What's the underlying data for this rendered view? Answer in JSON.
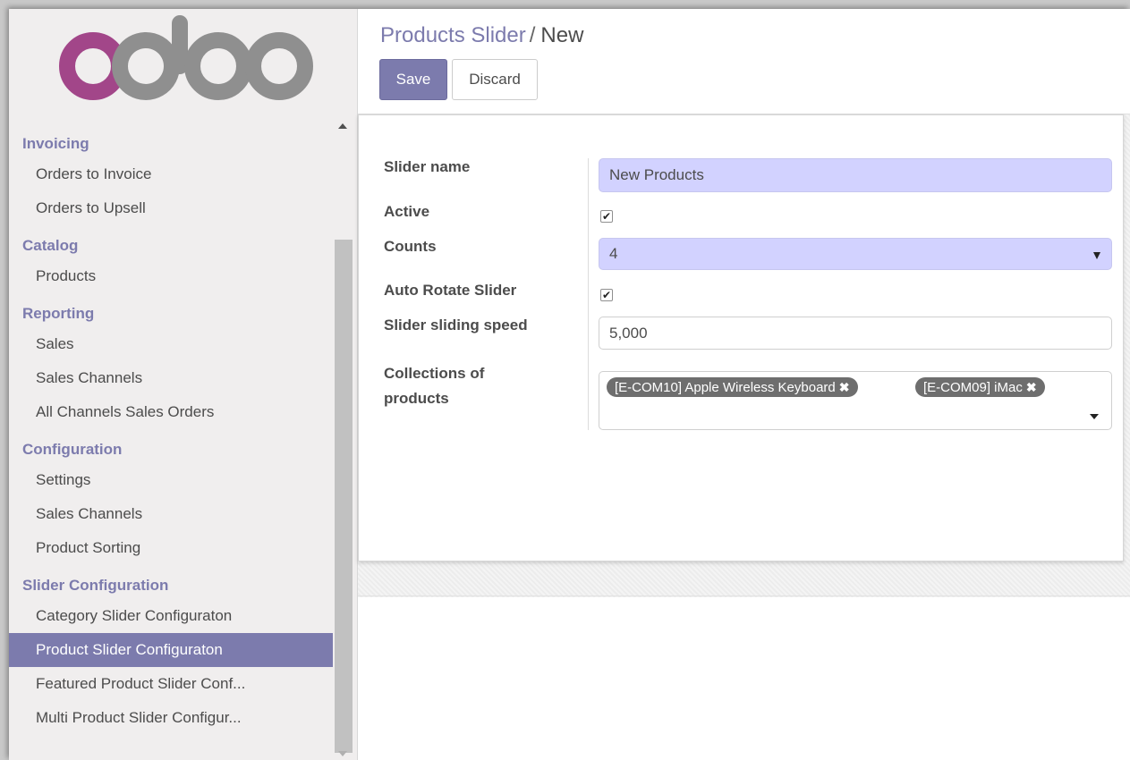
{
  "logo": {
    "text": "odoo"
  },
  "sidebar": {
    "sections": [
      {
        "title": "Invoicing",
        "items": [
          "Orders to Invoice",
          "Orders to Upsell"
        ]
      },
      {
        "title": "Catalog",
        "items": [
          "Products"
        ]
      },
      {
        "title": "Reporting",
        "items": [
          "Sales",
          "Sales Channels",
          "All Channels Sales Orders"
        ]
      },
      {
        "title": "Configuration",
        "items": [
          "Settings",
          "Sales Channels",
          "Product Sorting"
        ]
      },
      {
        "title": "Slider Configuration",
        "items": [
          "Category Slider Configuraton",
          "Product Slider Configuraton",
          "Featured Product Slider Conf...",
          "Multi Product Slider Configur..."
        ]
      }
    ],
    "active_item": "Product Slider Configuraton"
  },
  "breadcrumb": {
    "parent": "Products Slider",
    "separator": "/",
    "current": "New"
  },
  "buttons": {
    "save": "Save",
    "discard": "Discard"
  },
  "form": {
    "slider_name": {
      "label": "Slider name",
      "value": "New Products"
    },
    "active": {
      "label": "Active",
      "checked": true
    },
    "counts": {
      "label": "Counts",
      "value": "4"
    },
    "auto_rotate": {
      "label": "Auto Rotate Slider",
      "checked": true
    },
    "speed": {
      "label": "Slider sliding speed",
      "value": "5,000"
    },
    "collections": {
      "label_line1": "Collections of",
      "label_line2": "products",
      "tags": [
        "[E-COM10] Apple Wireless Keyboard",
        "[E-COM09] iMac"
      ]
    }
  },
  "colors": {
    "brand": "#7c7bad",
    "required_field": "#d2d2ff",
    "tag": "#6e6e6e"
  }
}
